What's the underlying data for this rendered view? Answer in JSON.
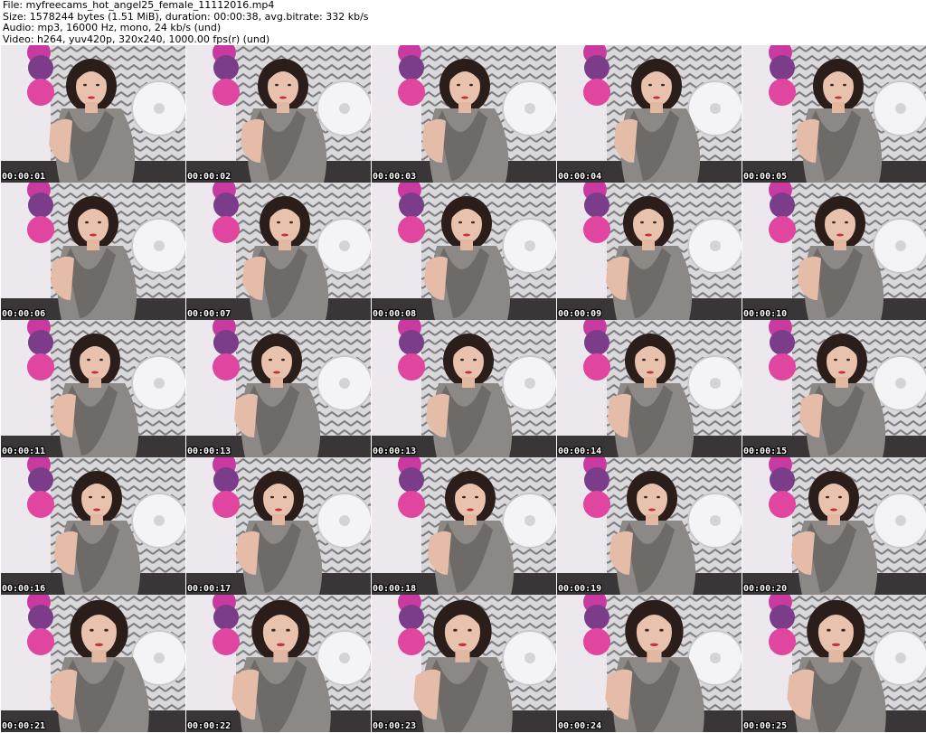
{
  "header": {
    "file_line": "File: myfreecams_hot_angel25_female_11112016.mp4",
    "size_line": "Size: 1578244 bytes (1.51 MiB), duration: 00:00:38, avg.bitrate: 332 kb/s",
    "audio_line": "Audio: mp3, 16000 Hz, mono, 24 kb/s (und)",
    "video_line": "Video: h264, yuv420p, 320x240, 1000.00 fps(r) (und)"
  },
  "frames": [
    {
      "timestamp": "00:00:01"
    },
    {
      "timestamp": "00:00:02"
    },
    {
      "timestamp": "00:00:03"
    },
    {
      "timestamp": "00:00:04"
    },
    {
      "timestamp": "00:00:05"
    },
    {
      "timestamp": "00:00:06"
    },
    {
      "timestamp": "00:00:07"
    },
    {
      "timestamp": "00:00:08"
    },
    {
      "timestamp": "00:00:09"
    },
    {
      "timestamp": "00:00:10"
    },
    {
      "timestamp": "00:00:11"
    },
    {
      "timestamp": "00:00:13"
    },
    {
      "timestamp": "00:00:13"
    },
    {
      "timestamp": "00:00:14"
    },
    {
      "timestamp": "00:00:15"
    },
    {
      "timestamp": "00:00:16"
    },
    {
      "timestamp": "00:00:17"
    },
    {
      "timestamp": "00:00:18"
    },
    {
      "timestamp": "00:00:19"
    },
    {
      "timestamp": "00:00:20"
    },
    {
      "timestamp": "00:00:21"
    },
    {
      "timestamp": "00:00:22"
    },
    {
      "timestamp": "00:00:23"
    },
    {
      "timestamp": "00:00:24"
    },
    {
      "timestamp": "00:00:25"
    }
  ],
  "colors": {
    "background": "#ffffff",
    "header_text": "#000000",
    "timestamp_text": "#ffffff",
    "timestamp_outline": "#000000"
  }
}
